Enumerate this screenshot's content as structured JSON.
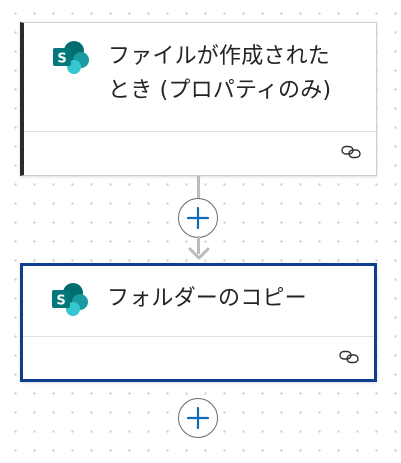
{
  "flow": {
    "trigger": {
      "app_icon": "sharepoint-icon",
      "title_line1": "ファイルが作成された",
      "title_line2": "とき (プロパティのみ)",
      "footer_icon": "link-icon"
    },
    "action": {
      "app_icon": "sharepoint-icon",
      "title": "フォルダーのコピー",
      "footer_icon": "link-icon"
    },
    "connector": {
      "add_icon": "plus-icon"
    }
  },
  "colors": {
    "canvas_dot": "#c9c9c9",
    "selected_border": "#0f3d8f",
    "trigger_accent": "#2b2b2b",
    "add_icon": "#0f6cbd",
    "sharepoint_dark": "#036c70",
    "sharepoint_mid": "#1a9ba1",
    "sharepoint_light": "#37c6d0"
  }
}
